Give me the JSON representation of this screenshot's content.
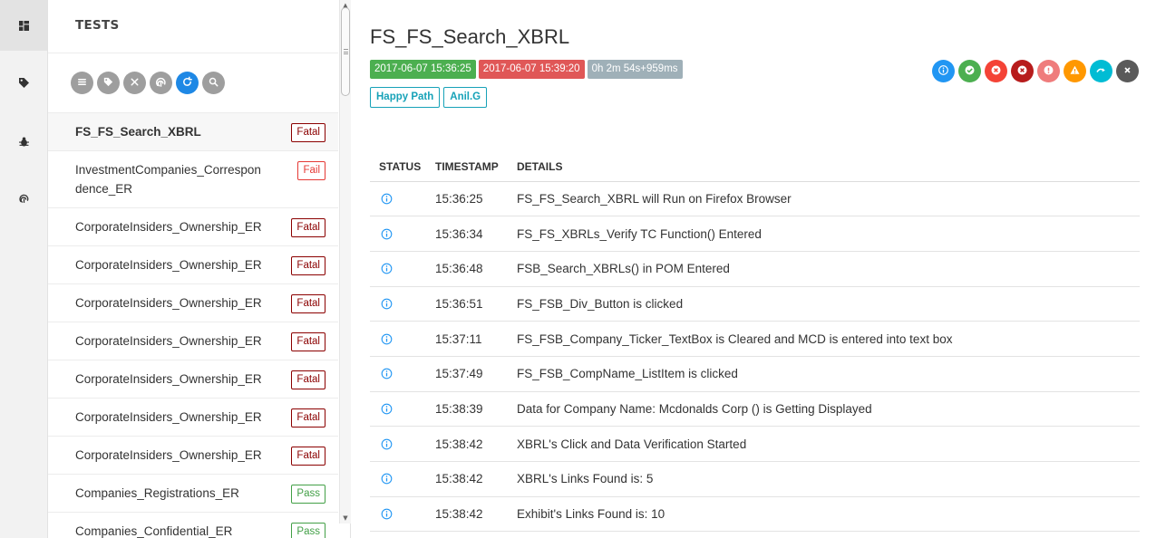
{
  "sidebar_nav": [
    {
      "name": "dashboard-view",
      "icon": "grid-icon"
    },
    {
      "name": "tags-view",
      "icon": "tag-icon"
    },
    {
      "name": "bugs-view",
      "icon": "bug-icon"
    },
    {
      "name": "exceptions-view",
      "icon": "fingerprint-icon"
    }
  ],
  "test_list": {
    "title": "TESTS",
    "toolbar": [
      {
        "icon": "list-icon"
      },
      {
        "icon": "tag-icon"
      },
      {
        "icon": "close-icon"
      },
      {
        "icon": "fingerprint-icon"
      },
      {
        "icon": "refresh-icon"
      },
      {
        "icon": "search-icon"
      }
    ],
    "items": [
      {
        "name": "FS_FS_Search_XBRL",
        "status": "Fatal"
      },
      {
        "name": "InvestmentCompanies_Correspondence_ER",
        "status": "Fail"
      },
      {
        "name": "CorporateInsiders_Ownership_ER",
        "status": "Fatal"
      },
      {
        "name": "CorporateInsiders_Ownership_ER",
        "status": "Fatal"
      },
      {
        "name": "CorporateInsiders_Ownership_ER",
        "status": "Fatal"
      },
      {
        "name": "CorporateInsiders_Ownership_ER",
        "status": "Fatal"
      },
      {
        "name": "CorporateInsiders_Ownership_ER",
        "status": "Fatal"
      },
      {
        "name": "CorporateInsiders_Ownership_ER",
        "status": "Fatal"
      },
      {
        "name": "CorporateInsiders_Ownership_ER",
        "status": "Fatal"
      },
      {
        "name": "Companies_Registrations_ER",
        "status": "Pass"
      },
      {
        "name": "Companies_Confidential_ER",
        "status": "Pass"
      }
    ]
  },
  "detail": {
    "title": "FS_FS_Search_XBRL",
    "start_time": "2017-06-07 15:36:25",
    "end_time": "2017-06-07 15:39:20",
    "duration": "0h 2m 54s+959ms",
    "categories": [
      "Happy Path",
      "Anil.G"
    ],
    "status_filters": [
      {
        "icon": "info-icon",
        "color": "#2196f3"
      },
      {
        "icon": "check-icon",
        "color": "#4caf50"
      },
      {
        "icon": "fail-x-icon",
        "color": "#f44336"
      },
      {
        "icon": "fatal-x-icon",
        "color": "#b71c1c"
      },
      {
        "icon": "error-icon",
        "color": "#ef7c7c"
      },
      {
        "icon": "warning-icon",
        "color": "#ff9800"
      },
      {
        "icon": "skip-icon",
        "color": "#00bcd4"
      },
      {
        "icon": "clear-icon",
        "color": "#5a5a5a"
      }
    ],
    "columns": {
      "status": "STATUS",
      "timestamp": "TIMESTAMP",
      "details": "DETAILS"
    },
    "logs": [
      {
        "status": "info",
        "time": "15:36:25",
        "details": "FS_FS_Search_XBRL will Run on Firefox Browser"
      },
      {
        "status": "info",
        "time": "15:36:34",
        "details": "FS_FS_XBRLs_Verify TC Function() Entered"
      },
      {
        "status": "info",
        "time": "15:36:48",
        "details": "FSB_Search_XBRLs() in POM Entered"
      },
      {
        "status": "info",
        "time": "15:36:51",
        "details": "FS_FSB_Div_Button is clicked"
      },
      {
        "status": "info",
        "time": "15:37:11",
        "details": "FS_FSB_Company_Ticker_TextBox is Cleared and MCD is entered into text box"
      },
      {
        "status": "info",
        "time": "15:37:49",
        "details": "FS_FSB_CompName_ListItem is clicked"
      },
      {
        "status": "info",
        "time": "15:38:39",
        "details": "Data for Company Name: Mcdonalds Corp () is Getting Displayed"
      },
      {
        "status": "info",
        "time": "15:38:42",
        "details": "XBRL's Click and Data Verification Started"
      },
      {
        "status": "info",
        "time": "15:38:42",
        "details": "XBRL's Links Found is: 5"
      },
      {
        "status": "info",
        "time": "15:38:42",
        "details": "Exhibit's Links Found is: 10"
      }
    ]
  },
  "colors": {
    "fatal": "#8b0000",
    "fail": "#e53935",
    "pass": "#43a047",
    "info": "#2196f3",
    "category": "#17a2b8"
  }
}
